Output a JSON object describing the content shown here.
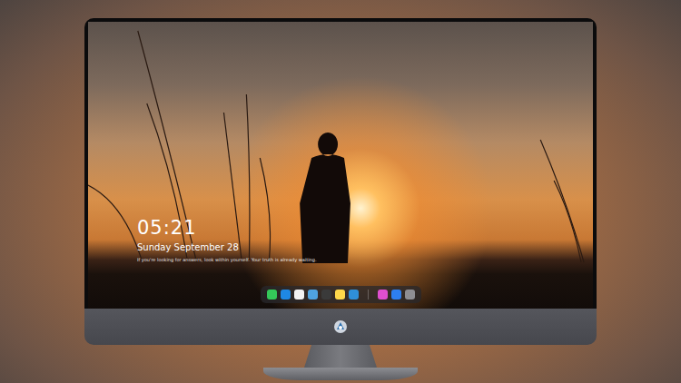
{
  "screen": {
    "time": "05:21",
    "date": "Sunday September 28",
    "caption": "If you're looking for answers, look within yourself. Your truth is already waiting."
  },
  "dock": {
    "apps": [
      {
        "color": "#34c759"
      },
      {
        "color": "#1e88e5"
      },
      {
        "color": "#f2f2f2"
      },
      {
        "color": "#4fa3e0"
      },
      {
        "color": "#3a3a3a"
      },
      {
        "color": "#ffd84a"
      },
      {
        "color": "#2f8fd8"
      }
    ],
    "pinned": [
      {
        "color": "#e04fd0"
      },
      {
        "color": "#2d7ff0"
      },
      {
        "color": "#8e8e93"
      }
    ]
  }
}
